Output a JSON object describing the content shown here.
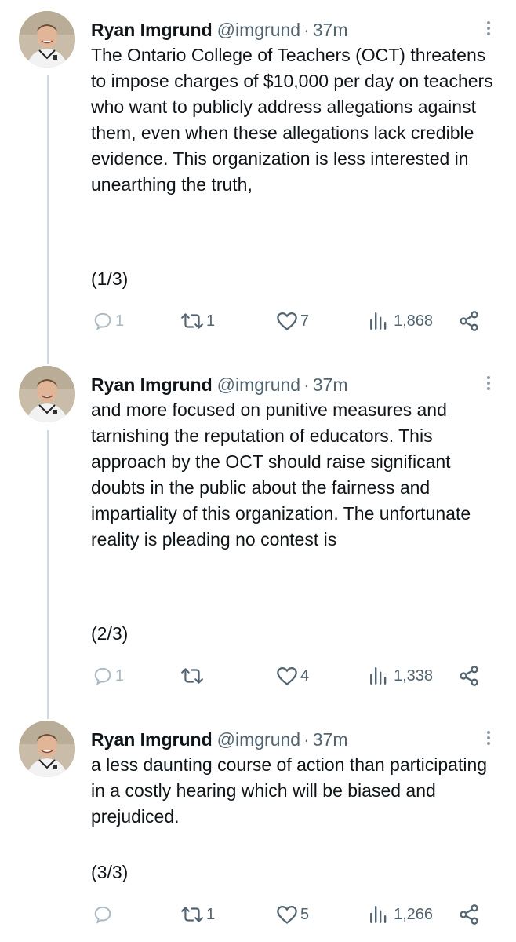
{
  "tweets": [
    {
      "name": "Ryan Imgrund",
      "handle": "@imgrund",
      "dot": "·",
      "time": "37m",
      "text": "The Ontario College of Teachers (OCT) threatens to impose charges of $10,000 per day on teachers who want to publicly address allegations against them, even when these allegations lack credible evidence. This organization is less interested in unearthing the truth,",
      "counter": "(1/3)",
      "replies": "1",
      "retweets": "1",
      "likes": "7",
      "views": "1,868"
    },
    {
      "name": "Ryan Imgrund",
      "handle": "@imgrund",
      "dot": "·",
      "time": "37m",
      "text": "and more focused on punitive measures and tarnishing the reputation of educators. This approach by the OCT should raise significant doubts in the public about the fairness and impartiality of this organization. The unfortunate reality is pleading no contest is",
      "counter": "(2/3)",
      "replies": "1",
      "retweets": "",
      "likes": "4",
      "views": "1,338"
    },
    {
      "name": "Ryan Imgrund",
      "handle": "@imgrund",
      "dot": "·",
      "time": "37m",
      "text": "a less daunting course of action than participating in a costly hearing which will be biased and prejudiced.",
      "counter": "(3/3)",
      "replies": "",
      "retweets": "1",
      "likes": "5",
      "views": "1,266"
    }
  ],
  "icons": {
    "reply": "reply-icon",
    "retweet": "retweet-icon",
    "like": "heart-icon",
    "views": "analytics-icon",
    "share": "share-icon",
    "more": "more-options-icon"
  },
  "colors": {
    "text": "#0f1419",
    "secondary": "#536471",
    "reply_faint": "#aab8c2",
    "thread_line": "#cfd9de"
  }
}
